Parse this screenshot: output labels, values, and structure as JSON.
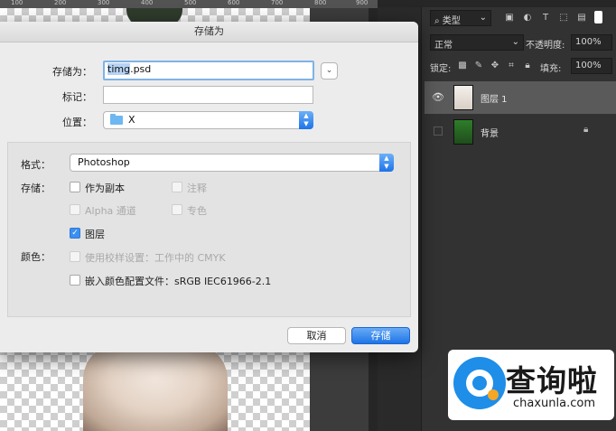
{
  "ruler": {
    "ticks": [
      "100",
      "200",
      "300",
      "400",
      "500",
      "600",
      "700",
      "800",
      "900"
    ]
  },
  "dialog": {
    "title": "存储为",
    "save_as_label": "存储为：",
    "filename_base": "timg",
    "filename_ext": ".psd",
    "tags_label": "标记：",
    "tags_value": "",
    "location_label": "位置：",
    "location_value": "X",
    "format_label": "格式：",
    "format_value": "Photoshop",
    "save_label": "存储：",
    "options": {
      "as_copy": "作为副本",
      "notes": "注释",
      "alpha_channels": "Alpha 通道",
      "spot_colors": "专色",
      "layers": "图层"
    },
    "color_label": "颜色：",
    "color_options": {
      "use_proof": "使用校样设置：工作中的 CMYK",
      "embed_profile": "嵌入颜色配置文件：sRGB IEC61966-2.1"
    },
    "cancel_label": "取消",
    "save_button_label": "存储"
  },
  "layers_panel": {
    "filter_kind": "类型",
    "blend_mode": "正常",
    "opacity_label": "不透明度:",
    "opacity_value": "100%",
    "lock_label": "锁定:",
    "fill_label": "填充:",
    "fill_value": "100%",
    "layers": [
      {
        "name": "图层 1",
        "visible": true,
        "selected": true
      },
      {
        "name": "背景",
        "visible": false,
        "locked": true
      }
    ]
  },
  "watermark": {
    "title": "查询啦",
    "url": "chaxunla.com"
  },
  "colors": {
    "accent": "#1f74e6",
    "ps_panel": "#323232",
    "dialog_bg": "#ececec"
  }
}
